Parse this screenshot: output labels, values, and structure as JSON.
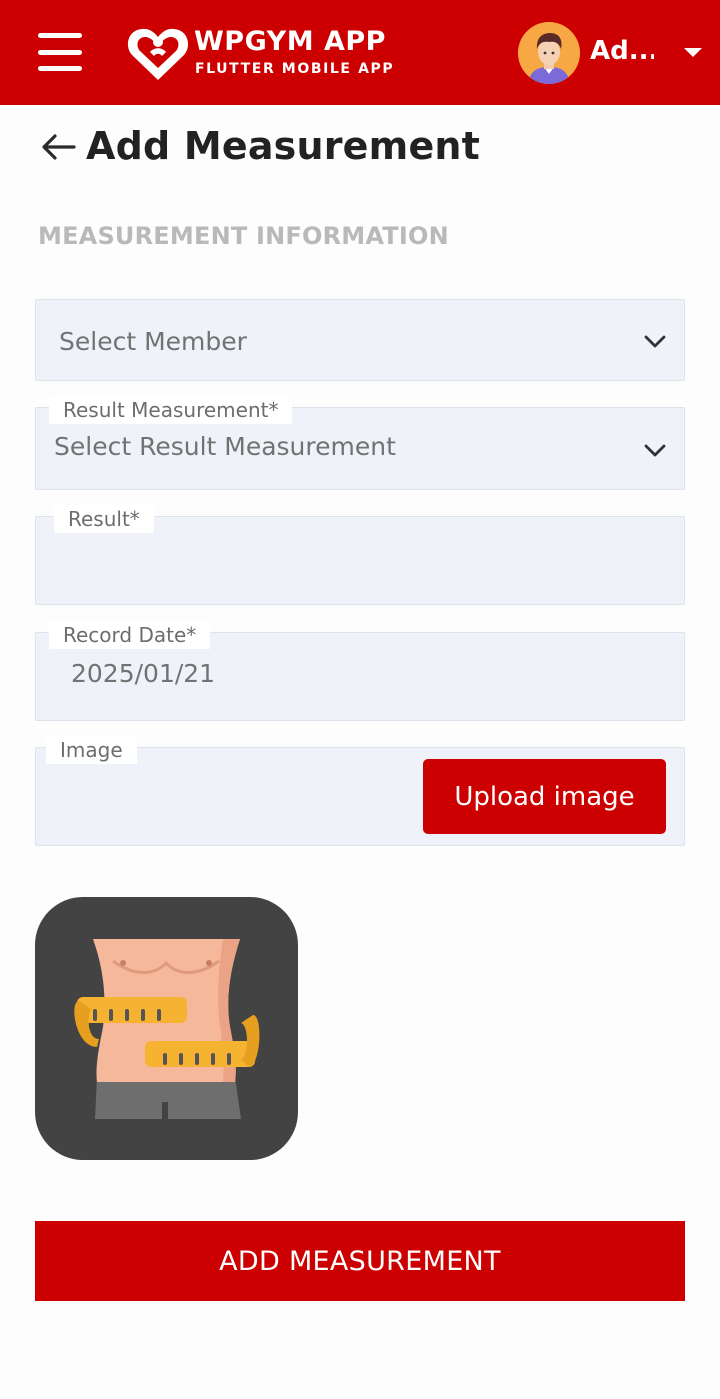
{
  "app": {
    "brand_title": "WPGYM APP",
    "brand_subtitle": "FLUTTER MOBILE APP",
    "user_name": "Ad...",
    "colors": {
      "primary": "#cc0000",
      "field_bg": "#eff3f9",
      "section_label": "#b9b9b9"
    }
  },
  "page": {
    "title": "Add Measurement",
    "section_label": "MEASUREMENT INFORMATION"
  },
  "form": {
    "member": {
      "value": "Select Member"
    },
    "result_measurement": {
      "label": "Result Measurement*",
      "value": "Select Result Measurement"
    },
    "result": {
      "label": "Result*",
      "value": ""
    },
    "record_date": {
      "label": "Record Date*",
      "value": "2025/01/21"
    },
    "image": {
      "label": "Image",
      "upload_label": "Upload image"
    }
  },
  "actions": {
    "submit_label": "ADD MEASUREMENT"
  },
  "icons": [
    "menu-icon",
    "heart-logo-icon",
    "avatar-icon",
    "caret-down-icon",
    "back-arrow-icon",
    "chevron-down-icon",
    "measurement-image"
  ]
}
